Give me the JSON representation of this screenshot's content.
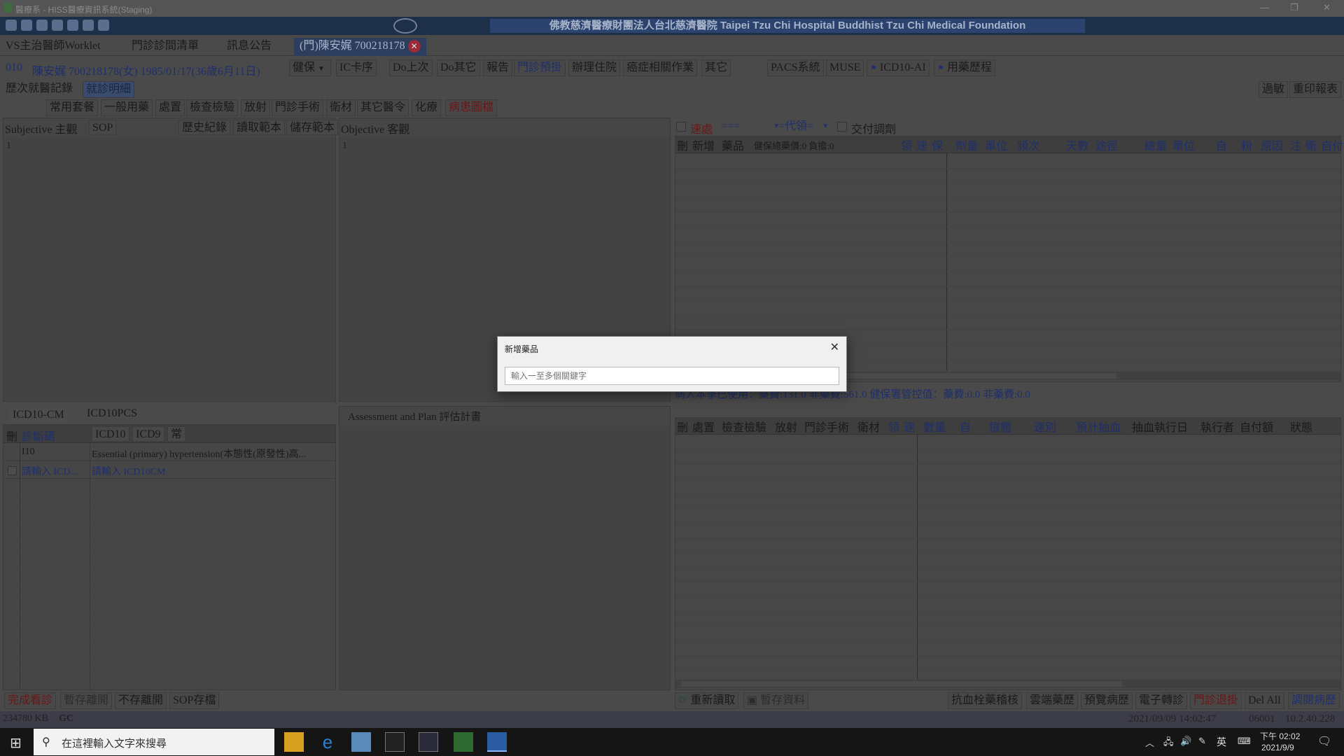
{
  "window": {
    "title": "醫療系 - HISS醫療資訊系統(Staging)"
  },
  "banner": {
    "hospital": "佛教慈濟醫療財團法人台北慈濟醫院 Taipei Tzu Chi Hospital Buddhist Tzu Chi Medical Foundation"
  },
  "main_tabs": [
    "VS主治醫師Worklet",
    "門診診間清單",
    "訊息公告",
    "(門)陳安娓 700218178"
  ],
  "patient": {
    "room": "010",
    "info": "陳安娓 700218178(女) 1985/01/17(36歲6月11日)",
    "insurance": "健保",
    "buttons": [
      "IC卡序",
      "Do上次",
      "Do其它",
      "報告",
      "門診預掛",
      "辦理住院",
      "癌症相關作業",
      "其它",
      "PACS系統",
      "MUSE",
      "ICD10-AI",
      "用藥歷程"
    ]
  },
  "sub_tabs": [
    "歷次就醫記錄",
    "就診明細"
  ],
  "right_top_buttons": [
    "過敏",
    "重印報表"
  ],
  "order_tabs": [
    "常用套餐",
    "一般用藥",
    "處置",
    "檢查檢驗",
    "放射",
    "門診手術",
    "衛材",
    "其它醫令",
    "化療",
    "病患圖檔"
  ],
  "subjective": {
    "label": "Subjective 主觀",
    "sop": "SOP",
    "history": "歷史紀錄",
    "read_template": "讀取範本",
    "save_template": "儲存範本",
    "line": "1"
  },
  "objective": {
    "label": "Objective 客觀",
    "line": "1"
  },
  "med_toolbar": {
    "urgent": "速處",
    "sel1": "===",
    "sel2": "=代領=",
    "deliver": "交付調劑"
  },
  "med_columns": [
    "刪",
    "新增",
    "藥品",
    "健保總藥價:0 負擔:0",
    "領",
    "速",
    "保",
    "劑量",
    "單位",
    "頻次",
    "天數",
    "途徑",
    "總量",
    "單位",
    "自",
    "粉",
    "原因",
    "注",
    "衛",
    "自付"
  ],
  "usage_summary": "病人本季已使用：藥費:131.0 非藥費:561.0 健保署管控值：藥費:0.0 非藥費:0.0",
  "icd_tabs": [
    "ICD10-CM",
    "ICD10PCS"
  ],
  "icd_columns": [
    "刪",
    "診斷碼",
    "ICD10",
    "ICD9",
    "常"
  ],
  "icd_rows": [
    {
      "code": "I10",
      "desc": "Essential (primary) hypertension(本態性(原發性)高..."
    },
    {
      "code": "請輸入 ICD...",
      "desc": "請輸入 ICD10CM"
    }
  ],
  "assessment": {
    "label": "Assessment and Plan 評估計畫"
  },
  "proc_columns": [
    "刪",
    "處置",
    "檢查檢驗",
    "放射",
    "門診手術",
    "衛材",
    "領",
    "速",
    "數量",
    "自",
    "檢體",
    "速別",
    "預計抽血",
    "抽血執行日",
    "執行者",
    "自付額",
    "狀態"
  ],
  "bottom_left_buttons": [
    "完成看診",
    "暫存離開",
    "不存離開",
    "SOP存檔"
  ],
  "bottom_mid_buttons": [
    "重新讀取",
    "暫存資料"
  ],
  "bottom_right_buttons": [
    "抗血栓藥稽核",
    "雲端藥歷",
    "預覽病歷",
    "電子轉診",
    "門診退掛",
    "Del All",
    "調閱病歷"
  ],
  "status": {
    "memory": "234780 KB",
    "gc": "GC",
    "datetime": "2021/09/09 14:02:47",
    "code": "06001",
    "ip": "10.2.40.228"
  },
  "dialog": {
    "title": "新增藥品",
    "placeholder": "輸入一至多個關鍵字"
  },
  "taskbar": {
    "search_placeholder": "在這裡輸入文字來搜尋",
    "ime": "英",
    "time": "下午 02:02",
    "date": "2021/9/9"
  }
}
